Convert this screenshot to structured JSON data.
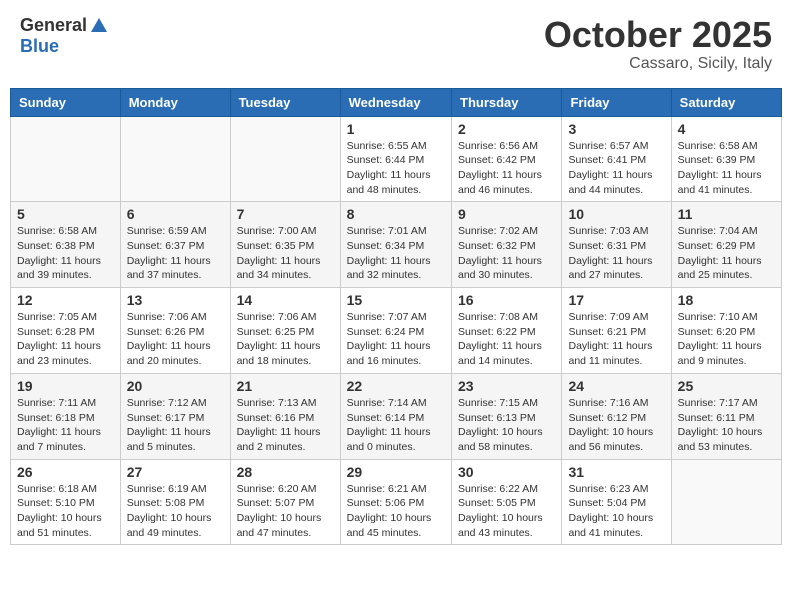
{
  "header": {
    "logo_general": "General",
    "logo_blue": "Blue",
    "month_title": "October 2025",
    "location": "Cassaro, Sicily, Italy"
  },
  "days_of_week": [
    "Sunday",
    "Monday",
    "Tuesday",
    "Wednesday",
    "Thursday",
    "Friday",
    "Saturday"
  ],
  "weeks": [
    [
      {
        "day": "",
        "empty": true
      },
      {
        "day": "",
        "empty": true
      },
      {
        "day": "",
        "empty": true
      },
      {
        "day": "1",
        "sunrise": "6:55 AM",
        "sunset": "6:44 PM",
        "daylight": "11 hours and 48 minutes."
      },
      {
        "day": "2",
        "sunrise": "6:56 AM",
        "sunset": "6:42 PM",
        "daylight": "11 hours and 46 minutes."
      },
      {
        "day": "3",
        "sunrise": "6:57 AM",
        "sunset": "6:41 PM",
        "daylight": "11 hours and 44 minutes."
      },
      {
        "day": "4",
        "sunrise": "6:58 AM",
        "sunset": "6:39 PM",
        "daylight": "11 hours and 41 minutes."
      }
    ],
    [
      {
        "day": "5",
        "sunrise": "6:58 AM",
        "sunset": "6:38 PM",
        "daylight": "11 hours and 39 minutes."
      },
      {
        "day": "6",
        "sunrise": "6:59 AM",
        "sunset": "6:37 PM",
        "daylight": "11 hours and 37 minutes."
      },
      {
        "day": "7",
        "sunrise": "7:00 AM",
        "sunset": "6:35 PM",
        "daylight": "11 hours and 34 minutes."
      },
      {
        "day": "8",
        "sunrise": "7:01 AM",
        "sunset": "6:34 PM",
        "daylight": "11 hours and 32 minutes."
      },
      {
        "day": "9",
        "sunrise": "7:02 AM",
        "sunset": "6:32 PM",
        "daylight": "11 hours and 30 minutes."
      },
      {
        "day": "10",
        "sunrise": "7:03 AM",
        "sunset": "6:31 PM",
        "daylight": "11 hours and 27 minutes."
      },
      {
        "day": "11",
        "sunrise": "7:04 AM",
        "sunset": "6:29 PM",
        "daylight": "11 hours and 25 minutes."
      }
    ],
    [
      {
        "day": "12",
        "sunrise": "7:05 AM",
        "sunset": "6:28 PM",
        "daylight": "11 hours and 23 minutes."
      },
      {
        "day": "13",
        "sunrise": "7:06 AM",
        "sunset": "6:26 PM",
        "daylight": "11 hours and 20 minutes."
      },
      {
        "day": "14",
        "sunrise": "7:06 AM",
        "sunset": "6:25 PM",
        "daylight": "11 hours and 18 minutes."
      },
      {
        "day": "15",
        "sunrise": "7:07 AM",
        "sunset": "6:24 PM",
        "daylight": "11 hours and 16 minutes."
      },
      {
        "day": "16",
        "sunrise": "7:08 AM",
        "sunset": "6:22 PM",
        "daylight": "11 hours and 14 minutes."
      },
      {
        "day": "17",
        "sunrise": "7:09 AM",
        "sunset": "6:21 PM",
        "daylight": "11 hours and 11 minutes."
      },
      {
        "day": "18",
        "sunrise": "7:10 AM",
        "sunset": "6:20 PM",
        "daylight": "11 hours and 9 minutes."
      }
    ],
    [
      {
        "day": "19",
        "sunrise": "7:11 AM",
        "sunset": "6:18 PM",
        "daylight": "11 hours and 7 minutes."
      },
      {
        "day": "20",
        "sunrise": "7:12 AM",
        "sunset": "6:17 PM",
        "daylight": "11 hours and 5 minutes."
      },
      {
        "day": "21",
        "sunrise": "7:13 AM",
        "sunset": "6:16 PM",
        "daylight": "11 hours and 2 minutes."
      },
      {
        "day": "22",
        "sunrise": "7:14 AM",
        "sunset": "6:14 PM",
        "daylight": "11 hours and 0 minutes."
      },
      {
        "day": "23",
        "sunrise": "7:15 AM",
        "sunset": "6:13 PM",
        "daylight": "10 hours and 58 minutes."
      },
      {
        "day": "24",
        "sunrise": "7:16 AM",
        "sunset": "6:12 PM",
        "daylight": "10 hours and 56 minutes."
      },
      {
        "day": "25",
        "sunrise": "7:17 AM",
        "sunset": "6:11 PM",
        "daylight": "10 hours and 53 minutes."
      }
    ],
    [
      {
        "day": "26",
        "sunrise": "6:18 AM",
        "sunset": "5:10 PM",
        "daylight": "10 hours and 51 minutes."
      },
      {
        "day": "27",
        "sunrise": "6:19 AM",
        "sunset": "5:08 PM",
        "daylight": "10 hours and 49 minutes."
      },
      {
        "day": "28",
        "sunrise": "6:20 AM",
        "sunset": "5:07 PM",
        "daylight": "10 hours and 47 minutes."
      },
      {
        "day": "29",
        "sunrise": "6:21 AM",
        "sunset": "5:06 PM",
        "daylight": "10 hours and 45 minutes."
      },
      {
        "day": "30",
        "sunrise": "6:22 AM",
        "sunset": "5:05 PM",
        "daylight": "10 hours and 43 minutes."
      },
      {
        "day": "31",
        "sunrise": "6:23 AM",
        "sunset": "5:04 PM",
        "daylight": "10 hours and 41 minutes."
      },
      {
        "day": "",
        "empty": true
      }
    ]
  ]
}
